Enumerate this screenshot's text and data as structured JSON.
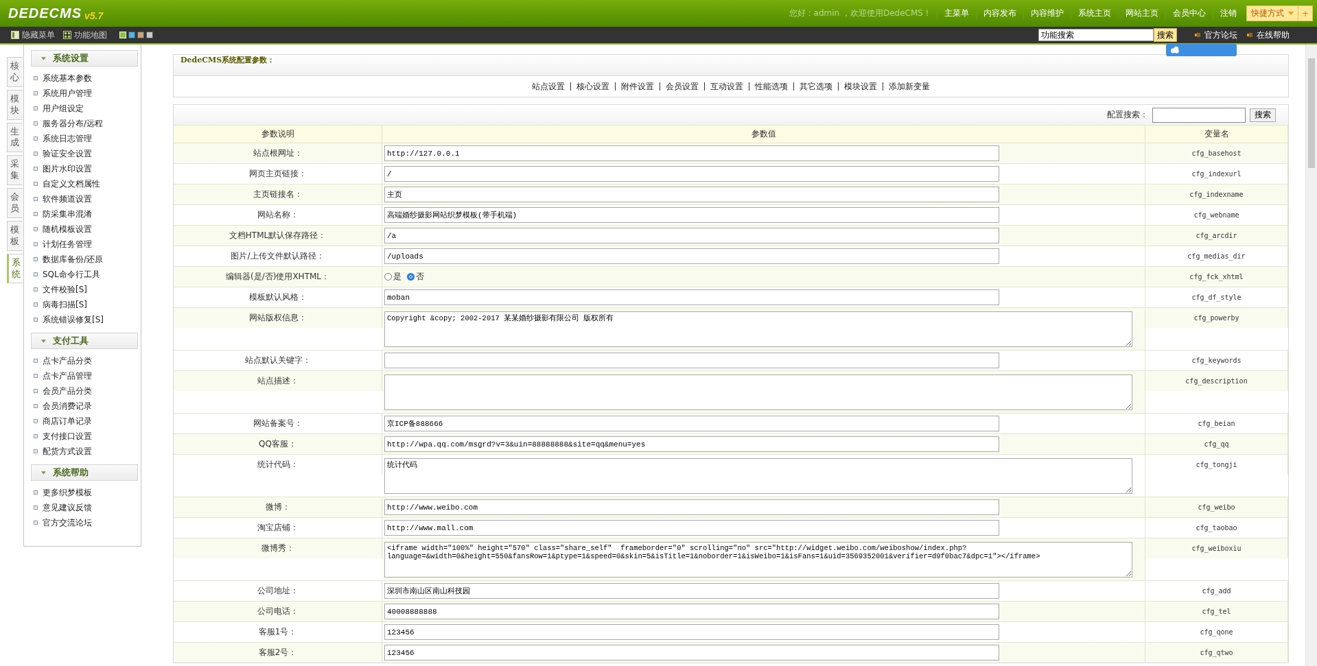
{
  "header": {
    "logo": "DEDECMS",
    "version": "v5.7",
    "greeting": "您好：admin ，欢迎使用DedeCMS！",
    "nav": [
      "主菜单",
      "内容发布",
      "内容维护",
      "系统主页",
      "网站主页",
      "会员中心",
      "注销"
    ],
    "quick": {
      "label": "快捷方式",
      "add": "+"
    }
  },
  "toolbar": {
    "left": [
      {
        "label": "隐藏菜单",
        "kind": "panel"
      },
      {
        "label": "功能地图",
        "kind": "grid"
      }
    ],
    "skins": [
      {
        "color": "#8cc43c",
        "selected": true
      },
      {
        "color": "#4fb3e8",
        "selected": false
      },
      {
        "color": "#c4a57a",
        "selected": false
      },
      {
        "color": "#c8c8c8",
        "selected": false
      }
    ],
    "search": {
      "value": "功能搜索",
      "button": "搜索"
    },
    "links": [
      "官方论坛",
      "在线帮助"
    ]
  },
  "side_tabs": [
    {
      "label": "核心",
      "selected": false
    },
    {
      "label": "模块",
      "selected": false
    },
    {
      "label": "生成",
      "selected": false
    },
    {
      "label": "采集",
      "selected": false
    },
    {
      "label": "会员",
      "selected": false
    },
    {
      "label": "模板",
      "selected": false
    },
    {
      "label": "系统",
      "selected": true
    }
  ],
  "menu": [
    {
      "title": "系统设置",
      "items": [
        "系统基本参数",
        "系统用户管理",
        "用户组设定",
        "服务器分布/远程",
        "系统日志管理",
        "验证安全设置",
        "图片水印设置",
        "自定义文档属性",
        "软件频道设置",
        "防采集串混淆",
        "随机模板设置",
        "计划任务管理",
        "数据库备份/还原",
        "SQL命令行工具",
        "文件校验[S]",
        "病毒扫描[S]",
        "系统错误修复[S]"
      ]
    },
    {
      "title": "支付工具",
      "items": [
        "点卡产品分类",
        "点卡产品管理",
        "会员产品分类",
        "会员消费记录",
        "商店订单记录",
        "支付接口设置",
        "配货方式设置"
      ]
    },
    {
      "title": "系统帮助",
      "items": [
        "更多织梦模板",
        "意见建议反馈",
        "官方交流论坛"
      ]
    }
  ],
  "config": {
    "title": "DedeCMS系统配置参数：",
    "sections": [
      "站点设置",
      "核心设置",
      "附件设置",
      "会员设置",
      "互动设置",
      "性能选项",
      "其它选项",
      "模块设置",
      "添加新变量"
    ],
    "search_label": "配置搜索：",
    "search_button": "搜索",
    "columns": [
      "参数说明",
      "参数值",
      "变量名"
    ],
    "rows": [
      {
        "label": "站点根网址：",
        "kind": "input",
        "value": "http://127.0.0.1",
        "var": "cfg_basehost"
      },
      {
        "label": "网页主页链接：",
        "kind": "input",
        "value": "/",
        "var": "cfg_indexurl"
      },
      {
        "label": "主页链接名：",
        "kind": "input",
        "value": "主页",
        "var": "cfg_indexname"
      },
      {
        "label": "网站名称：",
        "kind": "input",
        "value": "高端婚纱摄影网站织梦模板(带手机端)",
        "var": "cfg_webname"
      },
      {
        "label": "文档HTML默认保存路径：",
        "kind": "input",
        "value": "/a",
        "var": "cfg_arcdir"
      },
      {
        "label": "图片/上传文件默认路径：",
        "kind": "input",
        "value": "/uploads",
        "var": "cfg_medias_dir"
      },
      {
        "label": "编辑器(是/否)使用XHTML：",
        "kind": "radio",
        "options": [
          {
            "label": "是",
            "selected": false
          },
          {
            "label": "否",
            "selected": true
          }
        ],
        "var": "cfg_fck_xhtml"
      },
      {
        "label": "模板默认风格：",
        "kind": "input",
        "value": "moban",
        "var": "cfg_df_style"
      },
      {
        "label": "网站版权信息：",
        "kind": "textarea",
        "value": "Copyright &copy; 2002-2017 某某婚纱摄影有限公司 版权所有",
        "var": "cfg_powerby"
      },
      {
        "label": "站点默认关键字：",
        "kind": "input",
        "var": "cfg_keywords"
      },
      {
        "label": "站点描述：",
        "kind": "textarea",
        "var": "cfg_description"
      },
      {
        "label": "网站备案号：",
        "kind": "input",
        "value": "京ICP备888666",
        "var": "cfg_beian"
      },
      {
        "label": "QQ客服：",
        "kind": "input",
        "value": "http://wpa.qq.com/msgrd?v=3&uin=88888888&site=qq&menu=yes",
        "var": "cfg_qq"
      },
      {
        "label": "统计代码：",
        "kind": "textarea",
        "value": "统计代码",
        "var": "cfg_tongji"
      },
      {
        "label": "微博：",
        "kind": "input",
        "value": "http://www.weibo.com",
        "var": "cfg_weibo"
      },
      {
        "label": "淘宝店铺：",
        "kind": "input",
        "value": "http://www.mall.com",
        "var": "cfg_taobao"
      },
      {
        "label": "微博秀：",
        "kind": "textarea",
        "value": "<iframe width=\"100%\" height=\"570\" class=\"share_self\"  frameborder=\"0\" scrolling=\"no\" src=\"http://widget.weibo.com/weiboshow/index.php?language=&width=0&height=550&fansRow=1&ptype=1&speed=0&skin=5&isTitle=1&noborder=1&isWeibo=1&isFans=1&uid=3569352001&verifier=d9f0bac7&dpc=1\"></iframe>",
        "var": "cfg_weiboxiu"
      },
      {
        "label": "公司地址：",
        "kind": "input",
        "value": "深圳市南山区南山科技园",
        "var": "cfg_add"
      },
      {
        "label": "公司电话：",
        "kind": "input",
        "value": "40008888888",
        "var": "cfg_tel"
      },
      {
        "label": "客服1号：",
        "kind": "input",
        "value": "123456",
        "var": "cfg_qone"
      },
      {
        "label": "客服2号：",
        "kind": "input",
        "value": "123456",
        "var": "cfg_qtwo"
      }
    ]
  }
}
